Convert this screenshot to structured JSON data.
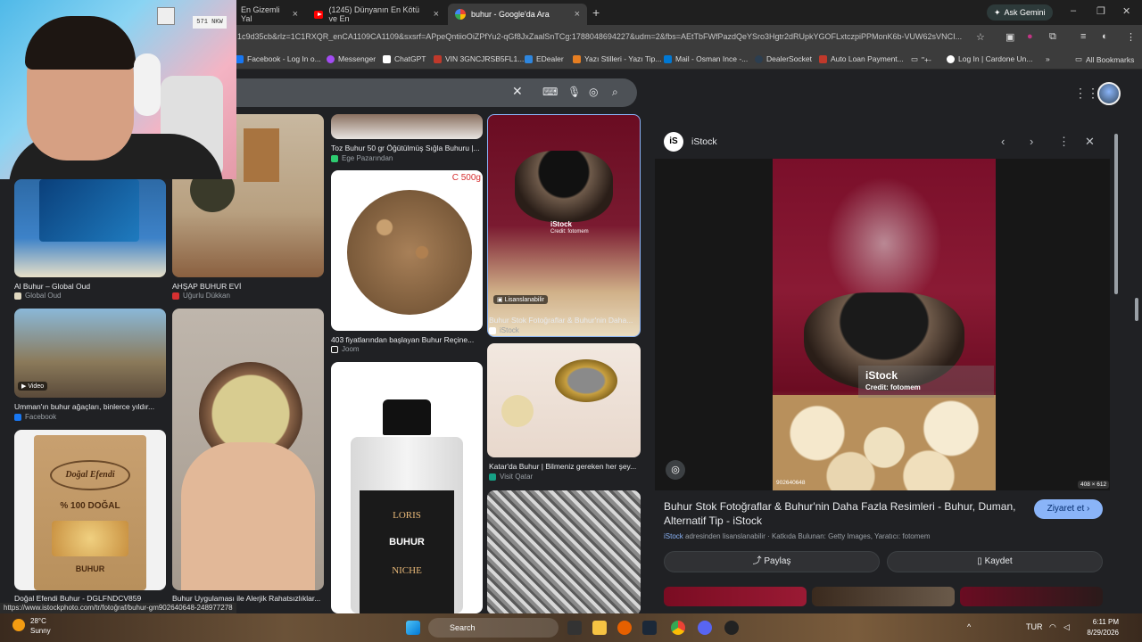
{
  "tabs": [
    {
      "title": "En Gizemli Yal",
      "icon": "document-icon"
    },
    {
      "title": "(1245) Dünyanın En Kötü ve En",
      "icon": "youtube-icon"
    },
    {
      "title": "buhur - Google'da Ara",
      "icon": "google-icon",
      "active": true
    }
  ],
  "gemini_label": "Ask Gemini",
  "address": {
    "url": "1c9d35cb&rlz=1C1RXQR_enCA1109CA1109&sxsrf=APpeQntiioOiZPfYu2-qGf8JxZaalSnTCg:1788048694227&udm=2&fbs=AEtTbFWfPazdQeYSro3Hgtr2dRUpkYGOFLxtczpiPPMonK6b-VUW62sVNCI..."
  },
  "bookmarks": [
    {
      "label": "Facebook - Log In o...",
      "color": "#1877f2"
    },
    {
      "label": "Messenger",
      "color": "#a34cf3"
    },
    {
      "label": "ChatGPT",
      "color": "#ffffff"
    },
    {
      "label": "VIN 3GNCJRSB5FL1...",
      "color": "#c0392b"
    },
    {
      "label": "EDealer",
      "color": "#2e86de"
    },
    {
      "label": "Yazı Stilleri - Yazı Tip...",
      "color": "#e67e22"
    },
    {
      "label": "Mail - Osman Ince -...",
      "color": "#0078d4"
    },
    {
      "label": "DealerSocket",
      "color": "#2c3e50"
    },
    {
      "label": "Auto Loan Payment...",
      "color": "#c0392b"
    },
    {
      "label": "\"+-",
      "color": "#aaaaaa"
    },
    {
      "label": "Log In | Cardone Un...",
      "color": "#ffffff"
    }
  ],
  "all_bookmarks": "All Bookmarks",
  "webcam": {
    "sign_text": "571 NKW"
  },
  "results": {
    "col2_top": {
      "caption": "Toz Buhur 50 gr Öğütülmüş Sığla Buhuru |...",
      "source": "Ege Pazarından"
    },
    "col3_top": {
      "caption": "Buhur Stok Fotoğraflar & Buhur'nin Daha...",
      "source": "iStock",
      "badge": "Lisanslanabilir",
      "wm_title": "iStock",
      "wm_credit": "Credit: fotomem"
    },
    "col0_a": {
      "caption": "Al Buhur – Global Oud",
      "source": "Global Oud"
    },
    "col1_a": {
      "caption": "AHŞAP BUHUR EVİ",
      "source": "Uğurlu Dükkan"
    },
    "col2_a": {
      "caption": "403 fiyatlarından başlayan Buhur Reçine...",
      "source": "Joom",
      "price_tag": "C 500g"
    },
    "col0_b": {
      "caption": "Umman'ın buhur ağaçları, binlerce yıldır...",
      "source": "Facebook",
      "badge": "Video"
    },
    "col3_b": {
      "caption": "Katar'da Buhur | Bilmeniz gereken her şey...",
      "source": "Visit Qatar"
    },
    "col0_c": {
      "caption": "Doğal Efendi Buhur - DGLFNDCV859",
      "product_brand": "Doğal Efendi",
      "product_line": "% 100 DOĞAL",
      "product_name": "BUHUR"
    },
    "col1_c": {
      "caption": "Buhur Uygulaması ile Alerjik Rahatsızlıklar..."
    },
    "col2_c": {
      "brand_top": "LORIS",
      "brand_mid": "BUHUR",
      "brand_bottom": "NICHE"
    }
  },
  "preview": {
    "site": "iStock",
    "watermark_title": "iStock",
    "watermark_credit": "Credit: fotomem",
    "image_id": "902640648",
    "dims": "408 × 612",
    "title": "Buhur Stok Fotoğraflar & Buhur'nin Daha Fazla Resimleri - Buhur, Duman, Alternatif Tip - iStock",
    "visit_label": "Ziyaret et",
    "license_site": "iStock",
    "license_text": " adresinden lisanslanabilir · Katkıda Bulunan: Getty Images, Yaratıcı: fotomem",
    "share_label": "Paylaş",
    "save_label": "Kaydet"
  },
  "status_url": "https://www.istockphoto.com/tr/fotoğraf/buhur-gm902640648-248977278",
  "taskbar": {
    "temp": "28°C",
    "weather": "Sunny",
    "search_label": "Search",
    "lang": "TUR",
    "time": "6:11 PM",
    "date": "8/29/2026"
  }
}
